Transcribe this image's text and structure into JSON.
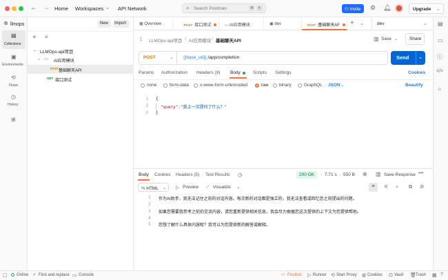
{
  "titlebar": {
    "nav_home": "Home",
    "nav_workspaces": "Workspaces",
    "nav_api_network": "API Network",
    "search_placeholder": "Search Postman",
    "search_shortcut_1": "⌘",
    "search_shortcut_2": "K",
    "invite_label": "Invite",
    "upgrade_label": "Upgrade"
  },
  "leftrail": {
    "items": [
      {
        "label": "Collections",
        "icon": "collections-icon"
      },
      {
        "label": "Environments",
        "icon": "environments-icon"
      },
      {
        "label": "Flows",
        "icon": "flows-icon"
      },
      {
        "label": "History",
        "icon": "history-icon"
      },
      {
        "label": "",
        "icon": "apps-icon"
      }
    ]
  },
  "sidebar": {
    "workspace": "llmops",
    "new_label": "New",
    "import_label": "Import",
    "tree": {
      "collection": "LLMOps-api项目",
      "folder": "AI应用模块",
      "active_request_method": "POST",
      "active_request": "基础聊天API",
      "other_request_method": "GET",
      "other_request": "接口测试"
    }
  },
  "tabs": {
    "items": [
      {
        "method": "",
        "label": "Overview",
        "dot": false
      },
      {
        "method": "POST",
        "label": "接口测试",
        "dot": true
      },
      {
        "method": "",
        "label": "AI应用模块",
        "dot": false
      },
      {
        "method": "",
        "label": "dev",
        "dot": false
      },
      {
        "method": "POST",
        "label": "基础聊天AF",
        "dot": true
      }
    ],
    "env_select": "dev"
  },
  "request": {
    "breadcrumb_collection": "LLMOps-api项目",
    "breadcrumb_folder": "AI应用模块",
    "breadcrumb_request": "基础聊天API",
    "save_label": "Save",
    "share_label": "Share",
    "method": "POST",
    "url_variable": "{{base_url}}",
    "url_path": "/app/completion",
    "send_label": "Send",
    "subtabs": {
      "params": "Params",
      "authorization": "Authorization",
      "headers": "Headers (9)",
      "body": "Body",
      "scripts": "Scripts",
      "settings": "Settings"
    },
    "cookies_label": "Cookies",
    "body_types": [
      "none",
      "form-data",
      "x-www-form-urlencoded",
      "raw",
      "binary",
      "GraphQL"
    ],
    "selected_body_type": "raw",
    "raw_format": "JSON",
    "beautify_label": "Beautify",
    "code_lines": [
      {
        "n": "1",
        "text": "{"
      },
      {
        "n": "2",
        "key": "\"query\"",
        "sep": ":",
        "val": "\"我上一次提问了什么？\""
      },
      {
        "n": "3",
        "text": "}"
      }
    ]
  },
  "response": {
    "tabs": {
      "body": "Body",
      "cookies": "Cookies",
      "headers": "Headers (5)",
      "test_results": "Test Results"
    },
    "status": "200 OK",
    "time": "7.71 s",
    "size": "550 B",
    "save_response": "Save Response",
    "format": "HTML",
    "preview_label": "Preview",
    "visualize_label": "Visualize",
    "lines": [
      {
        "n": "1",
        "text": "作为AI助手，我无法记住之前的对话内容。每次新的对话都是独立的，我无法查看或回忆您之前提出的问题。"
      },
      {
        "n": "2",
        "text": ""
      },
      {
        "n": "3",
        "text": "如果您需要我参考之前的交流内容，请您重新提供相关信息，我会尽力根据您这次提供的上下文为您提供帮助。"
      },
      {
        "n": "4",
        "text": ""
      },
      {
        "n": "5",
        "text": "您想了解什么具体内容呢？我可以为您提供新的解答或解释。"
      }
    ]
  },
  "statusbar": {
    "online": "Online",
    "find_replace": "Find and replace",
    "console": "Console",
    "postbot": "Postbot",
    "runner": "Runner",
    "start_proxy": "Start Proxy",
    "cookies": "Cookies",
    "vault": "Vault",
    "trash": "Trash"
  },
  "colors": {
    "accent": "#ff6c37",
    "send_blue": "#0265d2",
    "invite_blue": "#1f6bff",
    "status_ok": "#0c7a43"
  }
}
